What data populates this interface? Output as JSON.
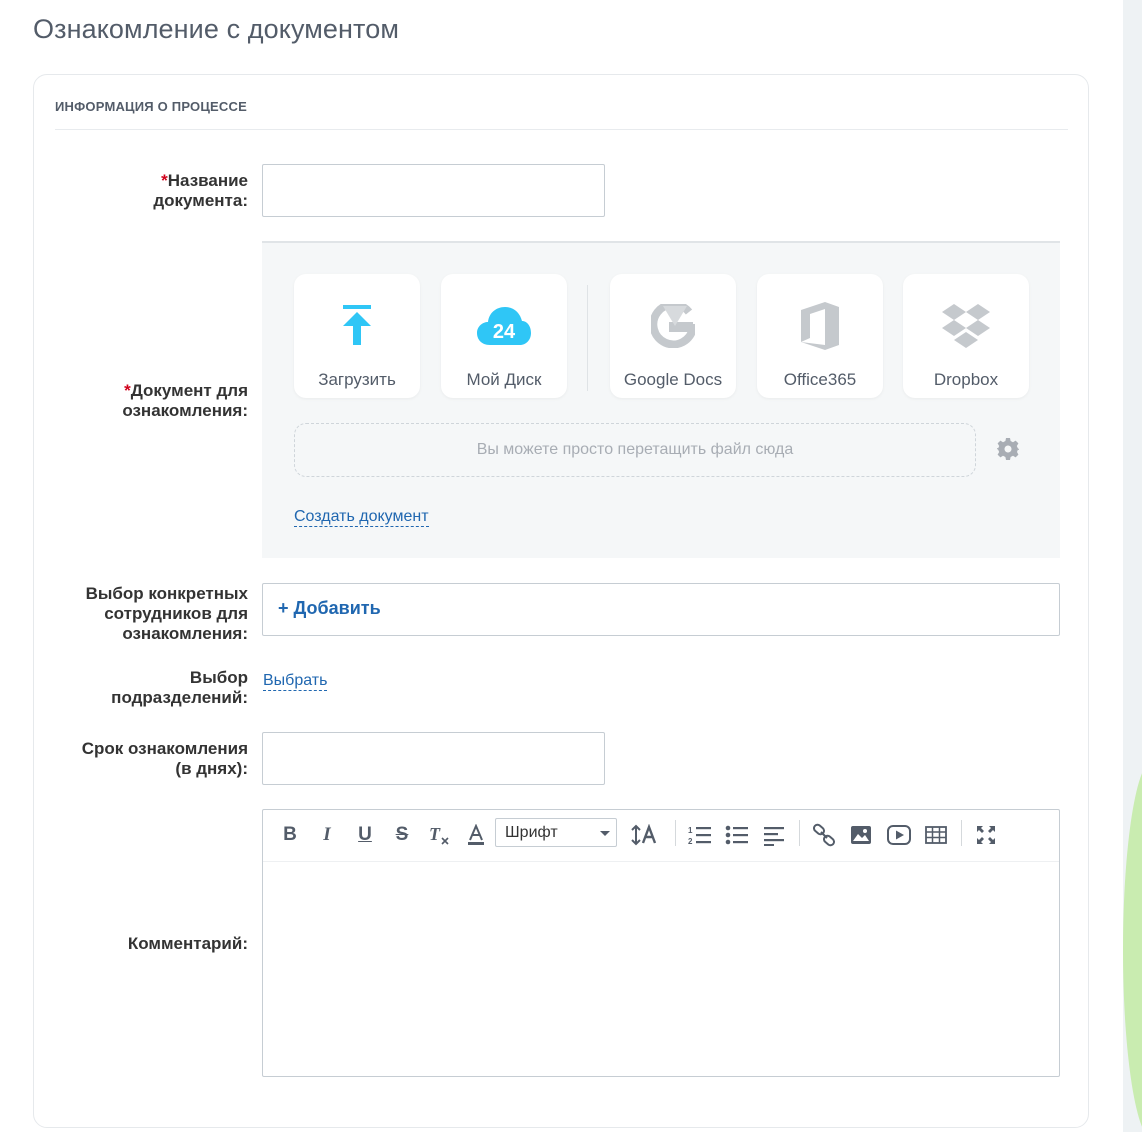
{
  "page": {
    "title": "Ознакомление с документом"
  },
  "section": {
    "title": "ИНФОРМАЦИЯ О ПРОЦЕССЕ"
  },
  "fields": {
    "doc_name": {
      "required_mark": "*",
      "label_line1": "Название",
      "label_line2": "документа:",
      "value": ""
    },
    "document": {
      "required_mark": "*",
      "label_line1": "Документ для",
      "label_line2": "ознакомления:"
    },
    "employees": {
      "label_line1": "Выбор конкретных",
      "label_line2": "сотрудников для",
      "label_line3": "ознакомления:",
      "add_label": "+ Добавить"
    },
    "departments": {
      "label_line1": "Выбор",
      "label_line2": "подразделений:",
      "choose_label": "Выбрать"
    },
    "term": {
      "label_line1": "Срок ознакомления",
      "label_line2": "(в днях):",
      "value": ""
    },
    "comment": {
      "label": "Комментарий:",
      "value": ""
    }
  },
  "uploader": {
    "sources": [
      {
        "label": "Загрузить",
        "icon": "upload-icon",
        "color": "#2fc6f6"
      },
      {
        "label": "Мой Диск",
        "icon": "cloud-24-icon",
        "icon_text": "24",
        "color": "#2fc6f6"
      },
      {
        "label": "Google Docs",
        "icon": "google-docs-icon",
        "color": "#c5c9cd"
      },
      {
        "label": "Office365",
        "icon": "office365-icon",
        "color": "#c5c9cd"
      },
      {
        "label": "Dropbox",
        "icon": "dropbox-icon",
        "color": "#c5c9cd"
      }
    ],
    "dropzone_text": "Вы можете просто перетащить файл сюда",
    "settings_icon": "gear-icon",
    "create_label": "Создать документ"
  },
  "editor": {
    "toolbar": [
      {
        "name": "bold",
        "icon": "bold-icon"
      },
      {
        "name": "italic",
        "icon": "italic-icon"
      },
      {
        "name": "underline",
        "icon": "underline-icon"
      },
      {
        "name": "strikethrough",
        "icon": "strikethrough-icon"
      },
      {
        "name": "clear-format",
        "icon": "clear-format-icon"
      },
      {
        "name": "text-color",
        "icon": "text-color-icon"
      },
      {
        "name": "font-size",
        "icon": "font-size-icon"
      },
      {
        "name": "ordered-list",
        "icon": "ordered-list-icon"
      },
      {
        "name": "bullet-list",
        "icon": "bullet-list-icon"
      },
      {
        "name": "align",
        "icon": "align-left-icon"
      },
      {
        "name": "link",
        "icon": "link-icon"
      },
      {
        "name": "image",
        "icon": "image-icon"
      },
      {
        "name": "video",
        "icon": "video-icon"
      },
      {
        "name": "table",
        "icon": "table-icon"
      },
      {
        "name": "fullscreen",
        "icon": "fullscreen-icon"
      }
    ],
    "font_select": {
      "value": "Шрифт"
    }
  },
  "colors": {
    "link": "#2067b0",
    "required": "#d0021b",
    "accent": "#2fc6f6",
    "label": "#333333",
    "muted": "#535c69"
  }
}
